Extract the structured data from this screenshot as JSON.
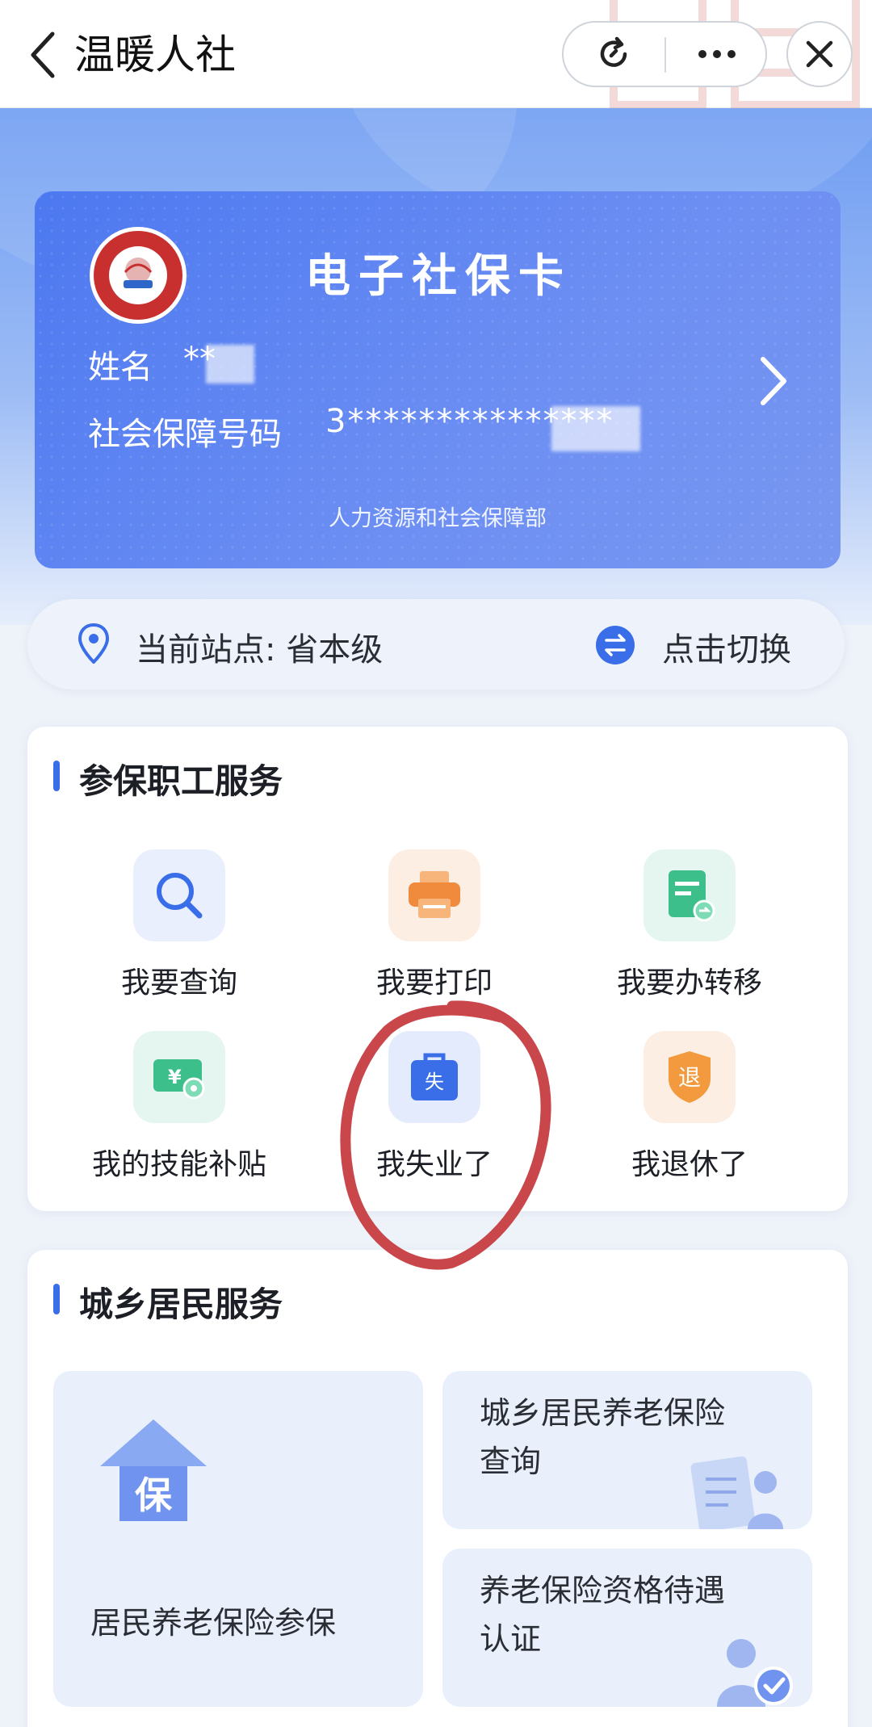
{
  "nav": {
    "title": "温暖人社"
  },
  "card": {
    "title": "电子社保卡",
    "name_label": "姓名",
    "name_value": "**",
    "ssn_label": "社会保障号码",
    "ssn_value": "3***************",
    "issuer": "人力资源和社会保障部",
    "color": "#5a80f0"
  },
  "station": {
    "label": "当前站点:  省本级",
    "switch_label": "点击切换"
  },
  "employee_section": {
    "title": "参保职工服务",
    "items": [
      {
        "label": "我要查询",
        "icon": "search-icon"
      },
      {
        "label": "我要打印",
        "icon": "printer-icon"
      },
      {
        "label": "我要办转移",
        "icon": "transfer-doc-icon"
      },
      {
        "label": "我的技能补贴",
        "icon": "subsidy-ticket-icon"
      },
      {
        "label": "我失业了",
        "icon": "unemployment-bag-icon",
        "icon_text": "失"
      },
      {
        "label": "我退休了",
        "icon": "retire-shield-icon",
        "icon_text": "退"
      }
    ]
  },
  "resident_section": {
    "title": "城乡居民服务",
    "big_tile": {
      "label": "居民养老保险参保",
      "icon_text": "保"
    },
    "tile1": {
      "line1": "城乡居民养老保险",
      "line2": "查询"
    },
    "tile2": {
      "line1": "养老保险资格待遇",
      "line2": "认证"
    }
  },
  "accent": "#3a6de8",
  "annotation_color": "#c9464a"
}
